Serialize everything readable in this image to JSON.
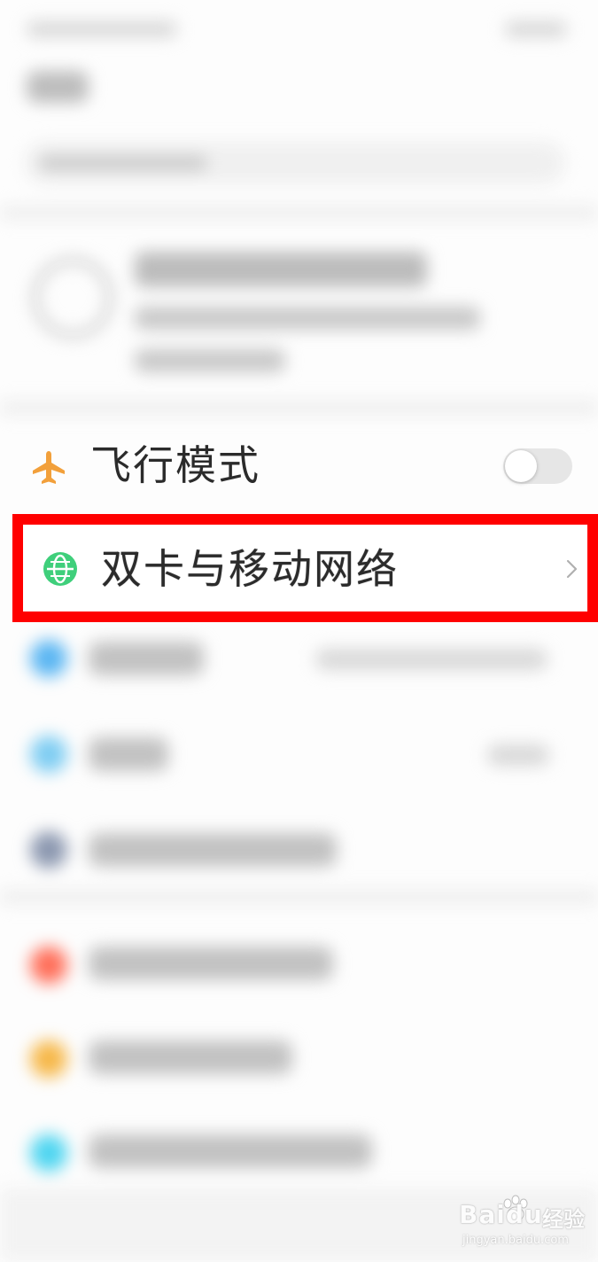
{
  "settings": {
    "airplane_mode": {
      "label": "飞行模式",
      "enabled": false,
      "icon": "airplane-icon",
      "icon_color": "#f2a03b"
    },
    "dual_sim": {
      "label": "双卡与移动网络",
      "icon": "globe-icon",
      "icon_color": "#3fcf7b",
      "highlighted": true,
      "highlight_color": "#ff0000"
    }
  },
  "blurred_icon_colors": [
    "#5bb6f2",
    "#7fcdf2",
    "#8c98b0",
    "#ff6f5a",
    "#f6b84a",
    "#4fd5f0"
  ],
  "watermark": {
    "brand": "Baidu",
    "suffix": "经验",
    "url": "jingyan.baidu.com"
  }
}
